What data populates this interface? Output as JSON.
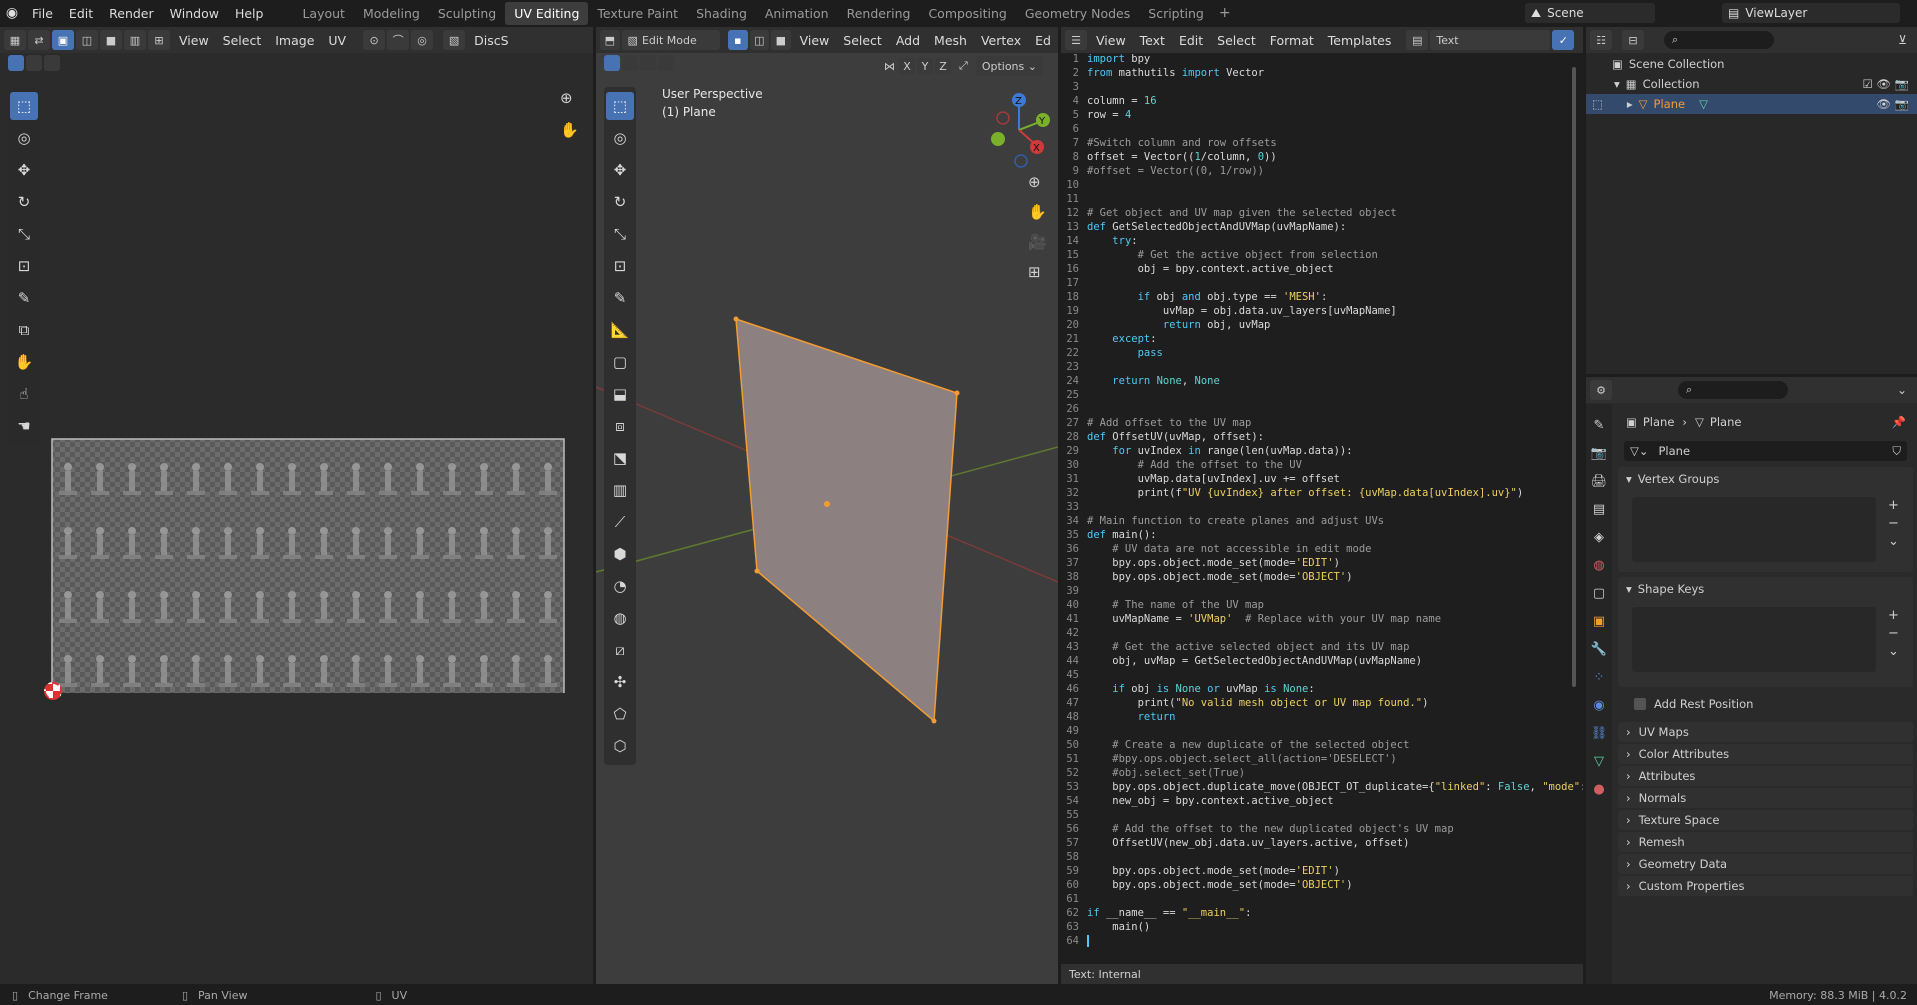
{
  "menu": [
    "File",
    "Edit",
    "Render",
    "Window",
    "Help"
  ],
  "workspaces": [
    {
      "label": "Layout",
      "active": false
    },
    {
      "label": "Modeling",
      "active": false
    },
    {
      "label": "Sculpting",
      "active": false
    },
    {
      "label": "UV Editing",
      "active": true
    },
    {
      "label": "Texture Paint",
      "active": false
    },
    {
      "label": "Shading",
      "active": false
    },
    {
      "label": "Animation",
      "active": false
    },
    {
      "label": "Rendering",
      "active": false
    },
    {
      "label": "Compositing",
      "active": false
    },
    {
      "label": "Geometry Nodes",
      "active": false
    },
    {
      "label": "Scripting",
      "active": false
    }
  ],
  "add_tab": "+",
  "scene": {
    "label": "Scene",
    "viewlayer": "ViewLayer"
  },
  "uv_editor": {
    "menus": [
      "View",
      "Select",
      "Image",
      "UV"
    ],
    "image_name": "DiscS"
  },
  "viewport": {
    "mode": "Edit Mode",
    "menus": [
      "View",
      "Select",
      "Add",
      "Mesh",
      "Vertex",
      "Ed"
    ],
    "perspective": "User Perspective",
    "object": "(1) Plane",
    "options": "Options",
    "axes": [
      "X",
      "Y",
      "Z"
    ]
  },
  "text_editor": {
    "menus": [
      "View",
      "Text",
      "Edit",
      "Select",
      "Format",
      "Templates"
    ],
    "text_name": "Text",
    "footer": "Text: Internal",
    "lines": [
      [
        [
          "k",
          "import"
        ],
        [
          "t",
          " bpy"
        ]
      ],
      [
        [
          "k",
          "from"
        ],
        [
          "t",
          " mathutils "
        ],
        [
          "k",
          "import"
        ],
        [
          "t",
          " Vector"
        ]
      ],
      [],
      [
        [
          "t",
          "column = "
        ],
        [
          "n",
          "16"
        ]
      ],
      [
        [
          "t",
          "row = "
        ],
        [
          "n",
          "4"
        ]
      ],
      [],
      [
        [
          "c",
          "#Switch column and row offsets"
        ]
      ],
      [
        [
          "t",
          "offset = Vector(("
        ],
        [
          "n",
          "1"
        ],
        [
          "t",
          "/column, "
        ],
        [
          "n",
          "0"
        ],
        [
          "t",
          "))"
        ]
      ],
      [
        [
          "c",
          "#offset = Vector((0, 1/row))"
        ]
      ],
      [],
      [],
      [
        [
          "c",
          "# Get object and UV map given the selected object"
        ]
      ],
      [
        [
          "k",
          "def"
        ],
        [
          "t",
          " GetSelectedObjectAndUVMap(uvMapName):"
        ]
      ],
      [
        [
          "t",
          "    "
        ],
        [
          "k",
          "try"
        ],
        [
          "t",
          ":"
        ]
      ],
      [
        [
          "c",
          "        # Get the active object from selection"
        ]
      ],
      [
        [
          "t",
          "        obj = bpy.context.active_object"
        ]
      ],
      [],
      [
        [
          "t",
          "        "
        ],
        [
          "k",
          "if"
        ],
        [
          "t",
          " obj "
        ],
        [
          "k",
          "and"
        ],
        [
          "t",
          " obj.type == "
        ],
        [
          "s",
          "'MESH'"
        ],
        [
          "t",
          ":"
        ]
      ],
      [
        [
          "t",
          "            uvMap = obj.data.uv_layers[uvMapName]"
        ]
      ],
      [
        [
          "t",
          "            "
        ],
        [
          "k",
          "return"
        ],
        [
          "t",
          " obj, uvMap"
        ]
      ],
      [
        [
          "t",
          "    "
        ],
        [
          "k",
          "except"
        ],
        [
          "t",
          ":"
        ]
      ],
      [
        [
          "t",
          "        "
        ],
        [
          "k",
          "pass"
        ]
      ],
      [],
      [
        [
          "t",
          "    "
        ],
        [
          "k",
          "return"
        ],
        [
          "t",
          " "
        ],
        [
          "n",
          "None"
        ],
        [
          "t",
          ", "
        ],
        [
          "n",
          "None"
        ]
      ],
      [],
      [],
      [
        [
          "c",
          "# Add offset to the UV map"
        ]
      ],
      [
        [
          "k",
          "def"
        ],
        [
          "t",
          " OffsetUV(uvMap, offset):"
        ]
      ],
      [
        [
          "t",
          "    "
        ],
        [
          "k",
          "for"
        ],
        [
          "t",
          " uvIndex "
        ],
        [
          "k",
          "in"
        ],
        [
          "t",
          " range(len(uvMap.data)):"
        ]
      ],
      [
        [
          "c",
          "        # Add the offset to the UV"
        ]
      ],
      [
        [
          "t",
          "        uvMap.data[uvIndex].uv += offset"
        ]
      ],
      [
        [
          "t",
          "        print(f"
        ],
        [
          "s",
          "\"UV {uvIndex} after offset: {uvMap.data[uvIndex].uv}\""
        ],
        [
          "t",
          ")"
        ]
      ],
      [],
      [
        [
          "c",
          "# Main function to create planes and adjust UVs"
        ]
      ],
      [
        [
          "k",
          "def"
        ],
        [
          "t",
          " main():"
        ]
      ],
      [
        [
          "c",
          "    # UV data are not accessible in edit mode"
        ]
      ],
      [
        [
          "t",
          "    bpy.ops.object.mode_set(mode="
        ],
        [
          "s",
          "'EDIT'"
        ],
        [
          "t",
          ")"
        ]
      ],
      [
        [
          "t",
          "    bpy.ops.object.mode_set(mode="
        ],
        [
          "s",
          "'OBJECT'"
        ],
        [
          "t",
          ")"
        ]
      ],
      [],
      [
        [
          "c",
          "    # The name of the UV map"
        ]
      ],
      [
        [
          "t",
          "    uvMapName = "
        ],
        [
          "s",
          "'UVMap'"
        ],
        [
          "c",
          "  # Replace with your UV map name"
        ]
      ],
      [],
      [
        [
          "c",
          "    # Get the active selected object and its UV map"
        ]
      ],
      [
        [
          "t",
          "    obj, uvMap = GetSelectedObjectAndUVMap(uvMapName)"
        ]
      ],
      [],
      [
        [
          "t",
          "    "
        ],
        [
          "k",
          "if"
        ],
        [
          "t",
          " obj "
        ],
        [
          "k",
          "is"
        ],
        [
          "t",
          " "
        ],
        [
          "n",
          "None"
        ],
        [
          "t",
          " "
        ],
        [
          "k",
          "or"
        ],
        [
          "t",
          " uvMap "
        ],
        [
          "k",
          "is"
        ],
        [
          "t",
          " "
        ],
        [
          "n",
          "None"
        ],
        [
          "t",
          ":"
        ]
      ],
      [
        [
          "t",
          "        print("
        ],
        [
          "s",
          "\"No valid mesh object or UV map found.\""
        ],
        [
          "t",
          ")"
        ]
      ],
      [
        [
          "t",
          "        "
        ],
        [
          "k",
          "return"
        ]
      ],
      [],
      [
        [
          "c",
          "    # Create a new duplicate of the selected object"
        ]
      ],
      [
        [
          "c",
          "    #bpy.ops.object.select_all(action='DESELECT')"
        ]
      ],
      [
        [
          "c",
          "    #obj.select_set(True)"
        ]
      ],
      [
        [
          "t",
          "    bpy.ops.object.duplicate_move(OBJECT_OT_duplicate={"
        ],
        [
          "s",
          "\"linked\""
        ],
        [
          "t",
          ": "
        ],
        [
          "n",
          "False"
        ],
        [
          "t",
          ", "
        ],
        [
          "s",
          "\"mode\""
        ],
        [
          "t",
          ": "
        ]
      ],
      [
        [
          "t",
          "    new_obj = bpy.context.active_object"
        ]
      ],
      [],
      [
        [
          "c",
          "    # Add the offset to the new duplicated object's UV map"
        ]
      ],
      [
        [
          "t",
          "    OffsetUV(new_obj.data.uv_layers.active, offset)"
        ]
      ],
      [],
      [
        [
          "t",
          "    bpy.ops.object.mode_set(mode="
        ],
        [
          "s",
          "'EDIT'"
        ],
        [
          "t",
          ")"
        ]
      ],
      [
        [
          "t",
          "    bpy.ops.object.mode_set(mode="
        ],
        [
          "s",
          "'OBJECT'"
        ],
        [
          "t",
          ")"
        ]
      ],
      [],
      [
        [
          "k",
          "if"
        ],
        [
          "t",
          " __name__ == "
        ],
        [
          "s",
          "\"__main__\""
        ],
        [
          "t",
          ":"
        ]
      ],
      [
        [
          "t",
          "    main()"
        ]
      ],
      []
    ]
  },
  "outliner": {
    "scene_collection": "Scene Collection",
    "collection": "Collection",
    "object": "Plane"
  },
  "properties": {
    "breadcrumb_obj": "Plane",
    "breadcrumb_data": "Plane",
    "mesh_name": "Plane",
    "vertex_groups": "Vertex Groups",
    "shape_keys": "Shape Keys",
    "add_rest": "Add Rest Position",
    "panels": [
      "UV Maps",
      "Color Attributes",
      "Attributes",
      "Normals",
      "Texture Space",
      "Remesh",
      "Geometry Data",
      "Custom Properties"
    ]
  },
  "status": {
    "change_frame": "Change Frame",
    "pan_view": "Pan View",
    "uv": "UV",
    "memory": "Memory: 88.3 MiB | 4.0.2"
  },
  "colors": {
    "keyword": "#4ec9f5",
    "string": "#ecd060",
    "number": "#5fd3d3",
    "comment": "#9b9b9b",
    "text": "#dadada",
    "accent": "#4772b3",
    "orange": "#f39c32"
  }
}
